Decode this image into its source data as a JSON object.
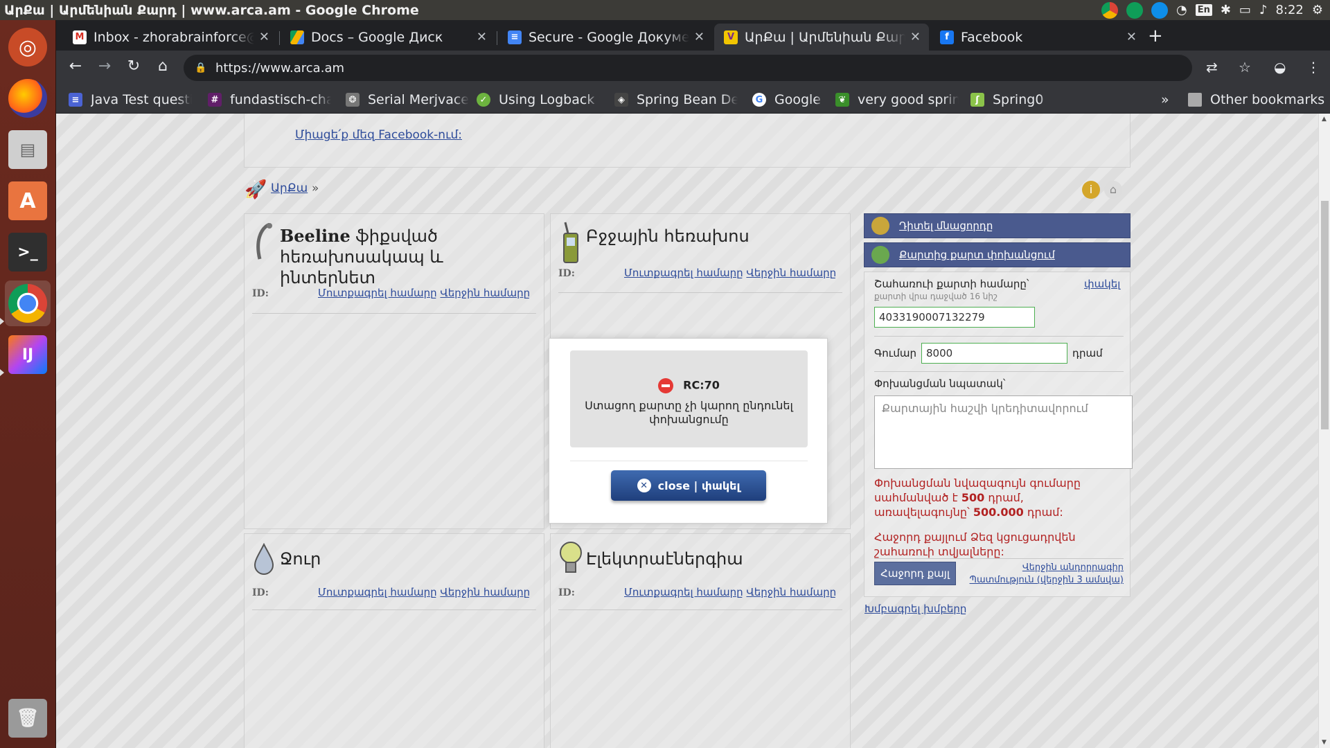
{
  "window": {
    "title": "ԱրՔա | Արմենիան Քարդ | www.arca.am - Google Chrome",
    "clock": "8:22",
    "lang": "En"
  },
  "launcher": {
    "apps": [
      "ubuntu-dash",
      "firefox",
      "files",
      "software-center",
      "terminal",
      "chrome",
      "intellij",
      "trash"
    ]
  },
  "tabs": [
    {
      "label": "Inbox - zhorabrainforce@",
      "favicon": "gmail-icon",
      "color": "#d93025"
    },
    {
      "label": "Docs – Google Диск",
      "favicon": "drive-icon",
      "color": "#f4b400"
    },
    {
      "label": "Secure - Google Докумен",
      "favicon": "docs-icon",
      "color": "#4285f4"
    },
    {
      "label": "ԱրՔա | Արմենիան Քարդ",
      "favicon": "arca-icon",
      "color": "#f2c500",
      "active": true
    },
    {
      "label": "Facebook",
      "favicon": "facebook-icon",
      "color": "#1877f2"
    }
  ],
  "toolbar": {
    "url": "https://www.arca.am"
  },
  "bookmarks": [
    {
      "label": "Java Test questio",
      "color": "#4b63d4"
    },
    {
      "label": "fundastisch-chat",
      "color": "#611f69"
    },
    {
      "label": "Serial Merjvace",
      "color": "#777"
    },
    {
      "label": "Using Logback w",
      "color": "#6db33f"
    },
    {
      "label": "Spring Bean Defi",
      "color": "#444"
    },
    {
      "label": "Google",
      "color": "#4285f4"
    },
    {
      "label": "very good spring",
      "color": "#3a8f2a"
    },
    {
      "label": "Spring0",
      "color": "#8bc34a"
    }
  ],
  "bookmarks_more": "»",
  "bookmarks_other": "Other bookmarks",
  "page": {
    "facebook_link": "Միացե՛ք մեզ Facebook-ում:",
    "breadcrumb": "ԱրՔա",
    "breadcrumb_sep": "»",
    "sections": [
      {
        "title_a": "Beeline",
        "title_b": "ֆիքսված հեռախոսակապ և ինտերնետ",
        "id_label": "ID:",
        "link1": "Մուտքագրել համարը",
        "link2": "Վերջին համարը"
      },
      {
        "title": "Բջջային հեռախոս",
        "id_label": "ID:",
        "link1": "Մուտքագրել համարը",
        "link2": "Վերջին համարը"
      },
      {
        "title": "Ջուր",
        "id_label": "ID:",
        "link1": "Մուտքագրել համարը",
        "link2": "Վերջին համարը"
      },
      {
        "title": "Էլեկտրաէներգիա",
        "id_label": "ID:",
        "link1": "Մուտքագրել համարը",
        "link2": "Վերջին համարը"
      }
    ],
    "side": {
      "btn1": "Դիտել մնացորդը",
      "btn2": "Քարտից քարտ փոխանցում",
      "card_label": "Շահառուի քարտի համարը՝",
      "card_sub": "քարտի վրա դաջված 16 նիշ",
      "close_link": "փակել",
      "card_value": "4033190007132279",
      "amount_label": "Գումար",
      "amount_value": "8000",
      "amount_unit": "դրամ",
      "purpose_label": "Փոխանցման նպատակ՝",
      "purpose_placeholder": "Քարտային հաշվի կրեդիտավորում",
      "note1a": "Փոխանցման նվազագույն գումարը սահմանված է ",
      "note1b": "500",
      "note1c": " դրամ,",
      "note1d": "առավելագույնը՝ ",
      "note1e": "500.000",
      "note1f": " դրամ:",
      "note2": "Հաջորդ քայլում Ձեզ կցուցադրվեն շահառուի տվյալները:",
      "next_btn": "Հաջորդ քայլ",
      "history_link": "Վերջին անդորրագիր Պատմություն (վերջին 3 ամսվա)",
      "edit_link": "Խմբագրել խմբերը"
    }
  },
  "modal": {
    "code": "RC:70",
    "message": "Ստացող քարտը չի կարող ընդունել փոխանցումը",
    "close_label": "close | փակել"
  }
}
